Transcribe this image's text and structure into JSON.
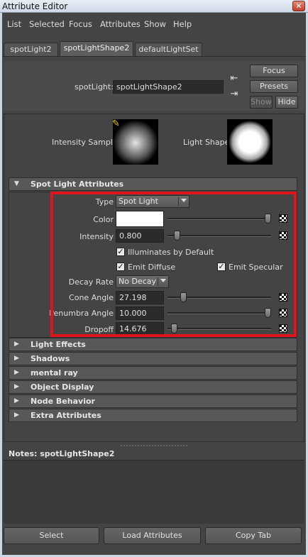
{
  "window": {
    "title": "Attribute Editor"
  },
  "menu": {
    "items": [
      "List",
      "Selected",
      "Focus",
      "Attributes",
      "Show",
      "Help"
    ]
  },
  "tabs": [
    {
      "label": "spotLight2"
    },
    {
      "label": "spotLightShape2"
    },
    {
      "label": "defaultLightSet"
    }
  ],
  "node": {
    "label": "spotLight:",
    "value": "spotLightShape2",
    "focus_label": "Focus",
    "presets_label": "Presets",
    "show_label": "Show",
    "hide_label": "Hide"
  },
  "swatches": {
    "intensity_label": "Intensity Sample",
    "shape_label": "Light Shape"
  },
  "spot_section": {
    "title": "Spot Light Attributes",
    "type_label": "Type",
    "type_value": "Spot Light",
    "color_label": "Color",
    "color_value": "#ffffff",
    "intensity_label": "Intensity",
    "intensity_value": "0.800",
    "illuminates_label": "Illuminates by Default",
    "emit_diffuse_label": "Emit Diffuse",
    "emit_specular_label": "Emit Specular",
    "decay_label": "Decay Rate",
    "decay_value": "No Decay",
    "cone_label": "Cone Angle",
    "cone_value": "27.198",
    "penumbra_label": "Penumbra Angle",
    "penumbra_value": "10.000",
    "dropoff_label": "Dropoff",
    "dropoff_value": "14.676"
  },
  "collapsed_sections": [
    {
      "title": "Light Effects"
    },
    {
      "title": "Shadows"
    },
    {
      "title": "mental ray"
    },
    {
      "title": "Object Display"
    },
    {
      "title": "Node Behavior"
    },
    {
      "title": "Extra Attributes"
    }
  ],
  "notes": {
    "label": "Notes:  spotLightShape2"
  },
  "bottom": {
    "select_label": "Select",
    "load_label": "Load Attributes",
    "copy_label": "Copy Tab"
  },
  "colors": {
    "highlight": "#e0141c",
    "panel": "#444444"
  }
}
